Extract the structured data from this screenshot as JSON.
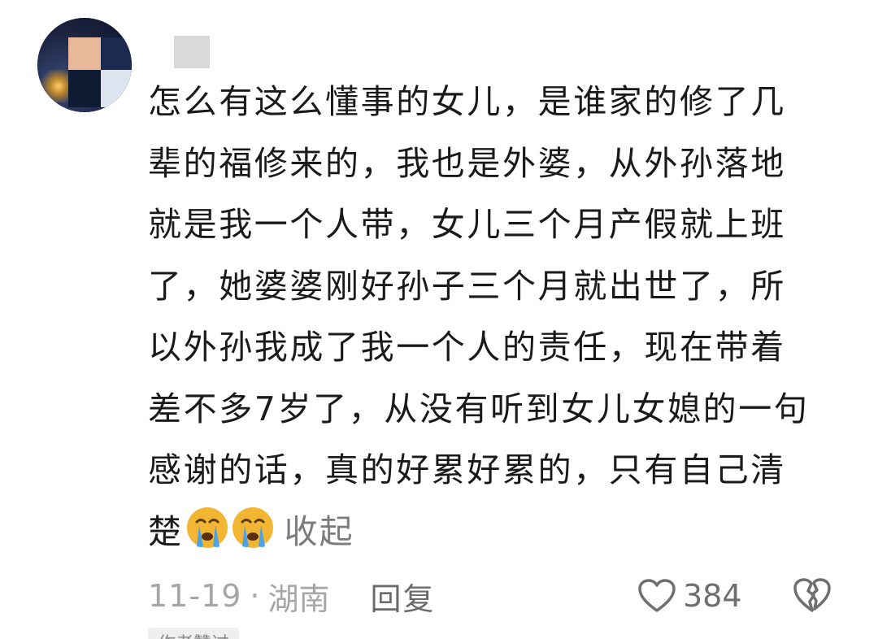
{
  "comment": {
    "username": "",
    "lines": [
      "怎么有这么懂事的女儿，是谁家的修了几",
      "辈的福修来的，我也是外婆，从外孙落地",
      "就是我一个人带，女儿三个月产假就上班",
      "了，她婆婆刚好孙子三个月就出世了，所",
      "以外孙我成了我一个人的责任，现在带着",
      "差不多7岁了，从没有听到女儿女媳的一句",
      "感谢的话，真的好累好累的，只有自己清"
    ],
    "last_line_text": "楚",
    "emojis": [
      "crying-emoji",
      "crying-emoji"
    ],
    "collapse_label": "收起"
  },
  "meta": {
    "date": "11-19",
    "separator": "·",
    "location": "湖南",
    "reply_label": "回复",
    "like_count": "384"
  },
  "bottom_tag": "作者赞过",
  "colors": {
    "text": "#1a1a1a",
    "meta": "#a6a6a6",
    "link": "#7b7b7b",
    "emoji_face": "#f2b632",
    "emoji_tear": "#4aa3e8"
  }
}
